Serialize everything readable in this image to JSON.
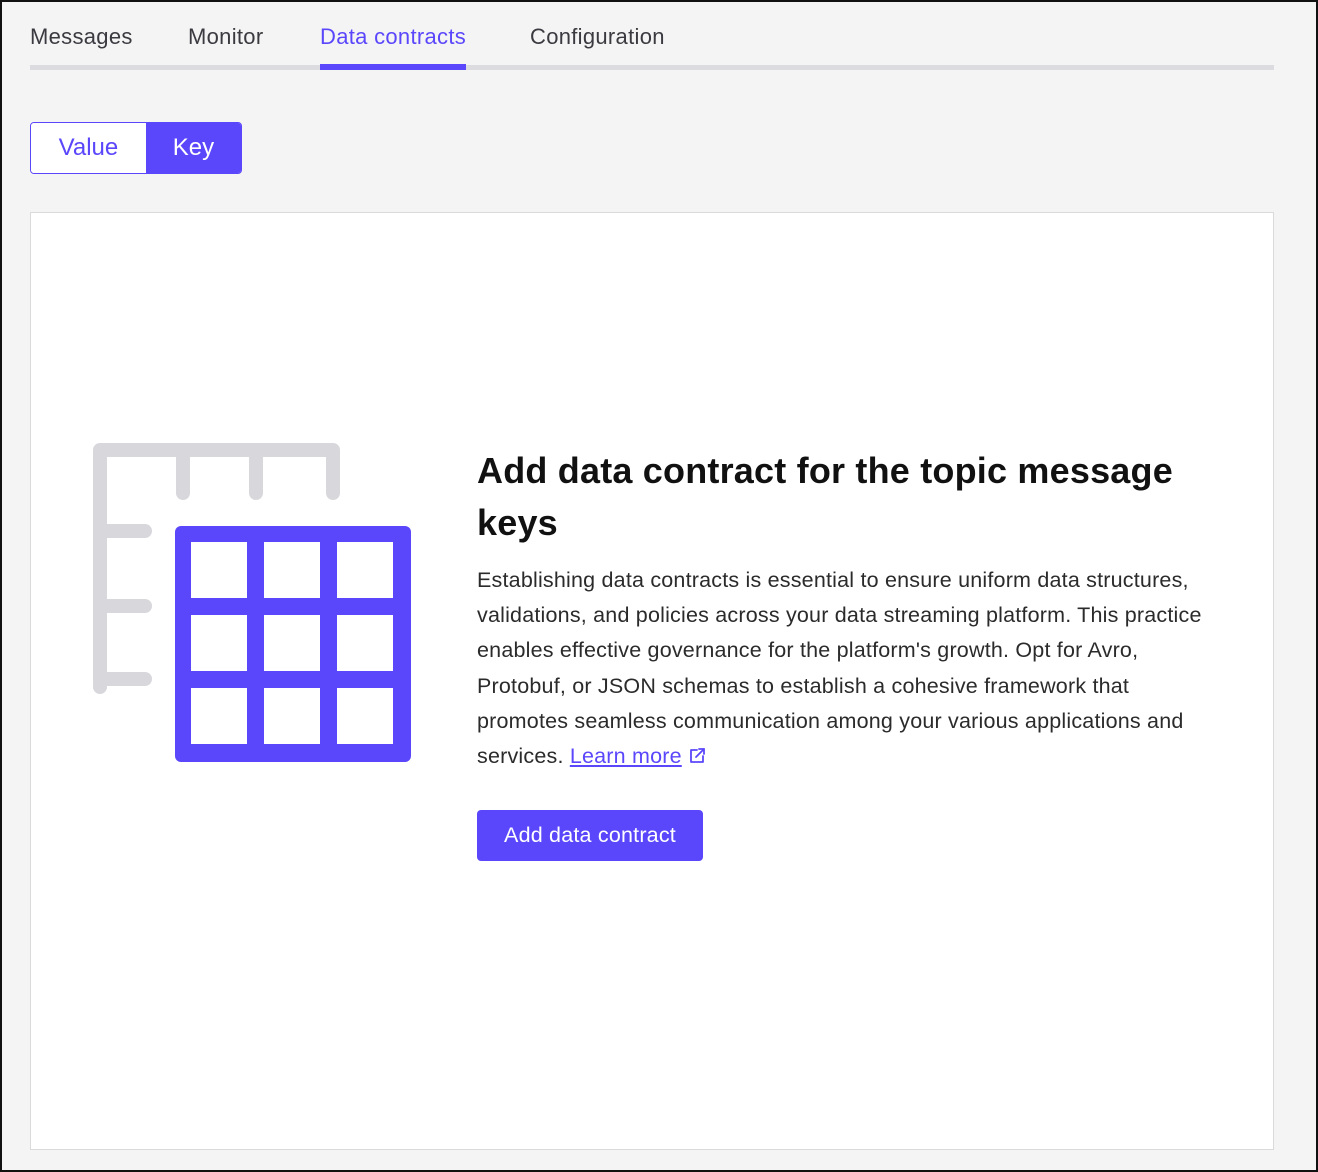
{
  "tabs": [
    {
      "label": "Messages",
      "active": false
    },
    {
      "label": "Monitor",
      "active": false
    },
    {
      "label": "Data contracts",
      "active": true
    },
    {
      "label": "Configuration",
      "active": false
    }
  ],
  "toggle": {
    "value_label": "Value",
    "key_label": "Key",
    "selected": "Key"
  },
  "empty_state": {
    "title": "Add data contract for the topic message keys",
    "description": "Establishing data contracts is essential to ensure uniform data structures, validations, and policies across your data streaming platform. This practice enables effective governance for the platform's growth. Opt for Avro, Protobuf, or JSON schemas to establish a cohesive framework that promotes seamless communication among your various applications and services.",
    "learn_more_label": "Learn more",
    "learn_more_icon": "external-link-icon",
    "button_label": "Add data contract",
    "illustration_icon": "table-grid-icon"
  },
  "colors": {
    "accent": "#5b47fb",
    "illustration_muted": "#d8d8dc",
    "background": "#f4f4f4"
  }
}
